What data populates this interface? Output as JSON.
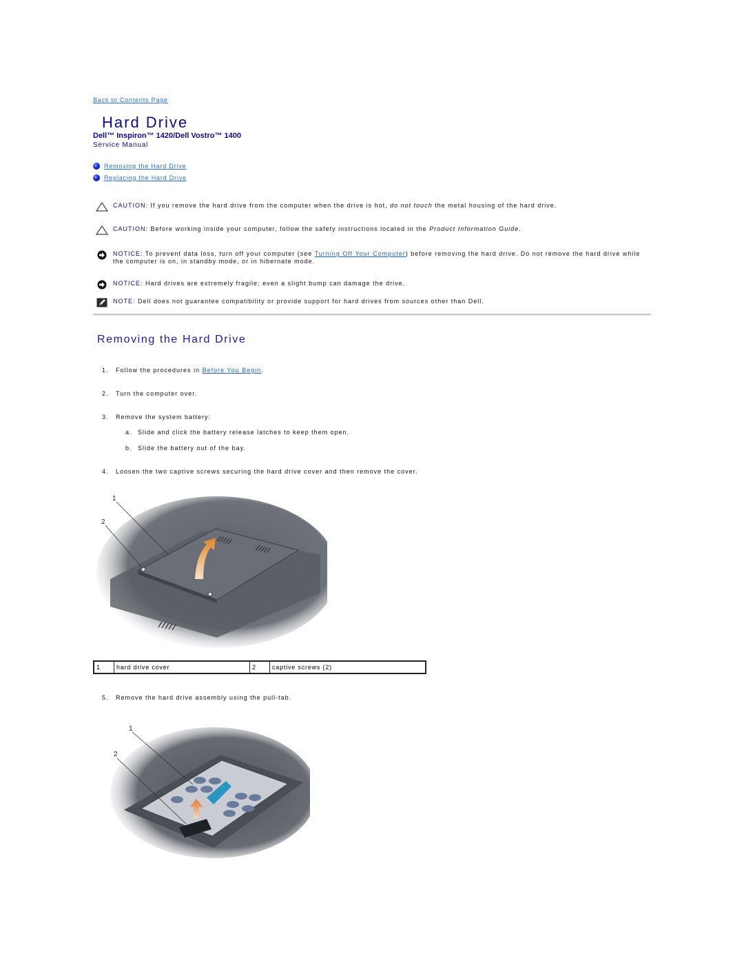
{
  "nav": {
    "back_link": "Back to Contents Page"
  },
  "header": {
    "title": "Hard Drive",
    "product": "Dell™ Inspiron™ 1420/Dell Vostro™ 1400",
    "manual": "Service Manual"
  },
  "toc": [
    {
      "label": "Removing the Hard Drive"
    },
    {
      "label": "Replacing the Hard Drive"
    }
  ],
  "notices": [
    {
      "type": "caution",
      "icon": "caution-triangle-icon",
      "label": "CAUTION:",
      "text_before": " If you remove the hard drive from the computer when the drive is hot, ",
      "emphasis": "do not touch",
      "text_after": " the metal housing of the hard drive."
    },
    {
      "type": "caution",
      "icon": "caution-triangle-icon",
      "label": "CAUTION:",
      "text_before": " Before working inside your computer, follow the safety instructions located in the ",
      "emphasis": "Product Information Guide",
      "text_after": "."
    },
    {
      "type": "notice",
      "icon": "notice-arrow-icon",
      "label": "NOTICE:",
      "text_before": " To prevent data loss, turn off your computer (see ",
      "link": "Turning Off Your Computer",
      "text_after": ") before removing the hard drive. Do not remove the hard drive while the computer is on, in standby mode, or in hibernate mode."
    },
    {
      "type": "notice",
      "icon": "notice-arrow-icon",
      "label": "NOTICE:",
      "text_before": " Hard drives are extremely fragile; even a slight bump can damage the drive."
    },
    {
      "type": "note",
      "icon": "note-pencil-icon",
      "label": "NOTE:",
      "text_before": " Dell does not guarantee compatibility or provide support for hard drives from sources other than Dell."
    }
  ],
  "section": {
    "title": "Removing the Hard Drive",
    "steps": [
      {
        "num": "1.",
        "text_before": "Follow the procedures in ",
        "link": "Before You Begin",
        "text_after": "."
      },
      {
        "num": "2.",
        "text_before": "Turn the computer over."
      },
      {
        "num": "3.",
        "text_before": "Remove the system battery:"
      },
      {
        "num": "4.",
        "text_before": "Loosen the two captive screws securing the hard drive cover and then remove the cover."
      },
      {
        "num": "5.",
        "text_before": "Remove the hard drive assembly using the pull-tab."
      }
    ],
    "substeps": [
      {
        "num": "a.",
        "text": "Slide and click the battery release latches to keep them open."
      },
      {
        "num": "b.",
        "text": "Slide the battery out of the bay."
      }
    ],
    "figure1": {
      "callouts": [
        "1",
        "2"
      ]
    },
    "legend": [
      {
        "num": "1",
        "label": "hard drive cover"
      },
      {
        "num": "2",
        "label": "captive screws (2)"
      }
    ],
    "figure2": {
      "callouts": [
        "1",
        "2"
      ]
    }
  },
  "colors": {
    "heading": "#0b0b7c",
    "link": "#2a6fd8",
    "rule": "#c4c4c4"
  }
}
